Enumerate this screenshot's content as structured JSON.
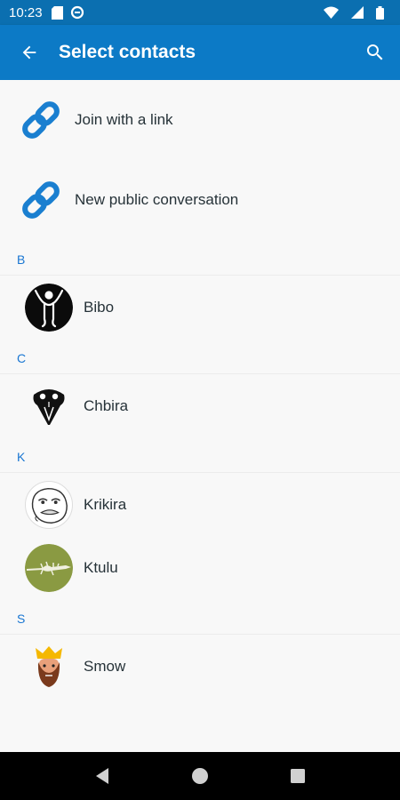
{
  "status_bar": {
    "time": "10:23"
  },
  "app_bar": {
    "title": "Select contacts"
  },
  "actions": [
    {
      "label": "Join with a link",
      "icon": "link-icon"
    },
    {
      "label": "New public conversation",
      "icon": "link-icon"
    }
  ],
  "sections": [
    {
      "letter": "B",
      "contacts": [
        {
          "name": "Bibo"
        }
      ]
    },
    {
      "letter": "C",
      "contacts": [
        {
          "name": "Chbira"
        }
      ]
    },
    {
      "letter": "K",
      "contacts": [
        {
          "name": "Krikira"
        },
        {
          "name": "Ktulu"
        }
      ]
    },
    {
      "letter": "S",
      "contacts": [
        {
          "name": "Smow"
        }
      ]
    }
  ],
  "colors": {
    "app_bar": "#0c7ac6",
    "status_bar": "#0b6fb0",
    "accent": "#1976d2",
    "link_icon": "#1a7fd0"
  }
}
